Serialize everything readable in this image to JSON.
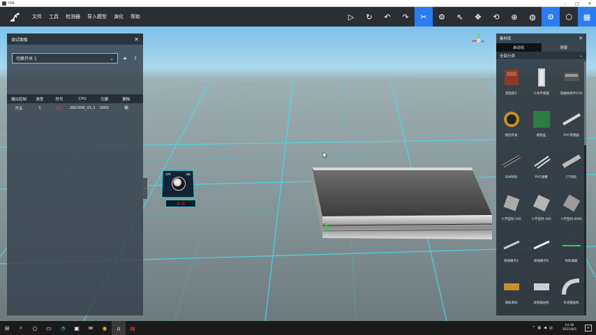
{
  "window": {
    "title": "IOA"
  },
  "menu": [
    "文件",
    "工具",
    "检测器",
    "导入模型",
    "演化",
    "帮助"
  ],
  "toolbar": [
    {
      "icon": "play-icon",
      "glyph": "▷",
      "active": false
    },
    {
      "icon": "refresh-icon",
      "glyph": "↻",
      "active": false
    },
    {
      "icon": "undo-icon",
      "glyph": "↶",
      "active": false
    },
    {
      "icon": "redo-icon",
      "glyph": "↷",
      "active": false
    },
    {
      "icon": "tools-icon",
      "glyph": "✂",
      "active": true
    },
    {
      "icon": "camera-icon",
      "glyph": "⚙",
      "active": false
    },
    {
      "icon": "select-cursor-icon",
      "glyph": "⇖",
      "active": false
    },
    {
      "icon": "move-icon",
      "glyph": "✥",
      "active": false
    },
    {
      "icon": "rotate-icon",
      "glyph": "⟲",
      "active": false
    },
    {
      "icon": "crosshair-icon",
      "glyph": "⊕",
      "active": false
    },
    {
      "icon": "globe-icon",
      "glyph": "◍",
      "active": false
    },
    {
      "icon": "settings-icon",
      "glyph": "⚙",
      "active": true
    },
    {
      "icon": "cube-icon",
      "glyph": "⬡",
      "active": false
    },
    {
      "icon": "grid-icon",
      "glyph": "▦",
      "active": true
    }
  ],
  "left_panel": {
    "title": "调试面板",
    "select_value": "切换开关 1",
    "columns": [
      "输出控制",
      "类型",
      "符号",
      "CPU",
      "引脚",
      "删除"
    ],
    "rows": [
      {
        "name": "开关",
        "type": "1",
        "symbol": "-D|-",
        "cpu": "ZKC008_V1.1",
        "pin": "DI00"
      }
    ]
  },
  "right_panel": {
    "title": "素材库",
    "tabs": [
      "自动化",
      "场景"
    ],
    "active_tab": 0,
    "category": "全部分类",
    "items": [
      {
        "label": "配电柜2"
      },
      {
        "label": "人体传感器"
      },
      {
        "label": "电磁阀组件(CA)"
      },
      {
        "label": "接近开关"
      },
      {
        "label": "植物盆"
      },
      {
        "label": "PVC传感器"
      },
      {
        "label": "DIN导轨"
      },
      {
        "label": "PVC线槽"
      },
      {
        "label": "CT导轨"
      },
      {
        "label": "十字型材-200"
      },
      {
        "label": "十字型材-300"
      },
      {
        "label": "十字型材-4000"
      },
      {
        "label": "接线端子4"
      },
      {
        "label": "接线端子8"
      },
      {
        "label": "导轨端板"
      },
      {
        "label": "滑轨滑块"
      },
      {
        "label": "滚筒输送机"
      },
      {
        "label": "弯道输送机"
      }
    ]
  },
  "scene": {
    "switch_labels": {
      "off": "OFF",
      "on": "ON"
    },
    "switch_tag": "A-0"
  },
  "taskbar": {
    "time": "14:36",
    "date": "2021/8/5"
  },
  "colors": {
    "accent": "#2b7cf0",
    "grid": "#25d4e3",
    "tag_text": "#ff2b2b"
  }
}
